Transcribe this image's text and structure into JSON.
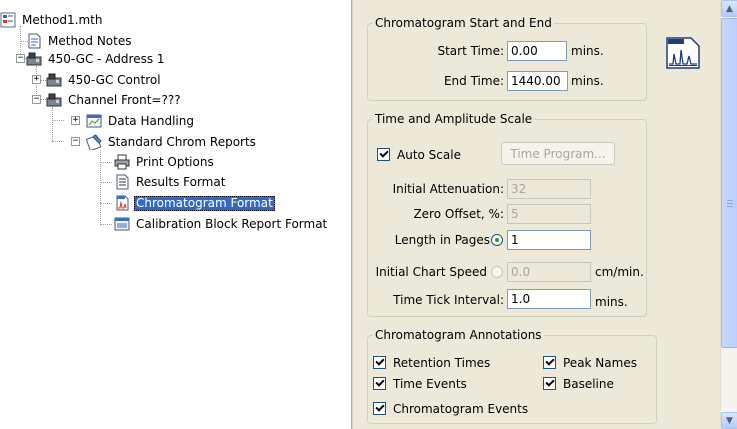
{
  "tree": {
    "root": {
      "label": "Method1.mth"
    },
    "method_notes": {
      "label": "Method Notes"
    },
    "address": {
      "label": "450-GC - Address 1"
    },
    "gc_control": {
      "label": "450-GC Control"
    },
    "channel": {
      "label": "Channel Front=???"
    },
    "data_handling": {
      "label": "Data Handling"
    },
    "std_reports": {
      "label": "Standard Chrom Reports"
    },
    "print_options": {
      "label": "Print Options"
    },
    "results_format": {
      "label": "Results Format"
    },
    "chromatogram_format": {
      "label": "Chromatogram Format",
      "selected": true
    },
    "calibration_block": {
      "label": "Calibration Block Report Format"
    }
  },
  "start_end": {
    "legend": "Chromatogram Start and End",
    "start_label": "Start Time:",
    "start_value": "0.00",
    "start_unit": "mins.",
    "end_label": "End Time:",
    "end_value": "1440.00",
    "end_unit": "mins."
  },
  "scale": {
    "legend": "Time and Amplitude Scale",
    "auto_scale_label": "Auto Scale",
    "auto_scale_checked": true,
    "time_program_label": "Time Program...",
    "atten_label": "Initial Attenuation:",
    "atten_value": "32",
    "zero_label": "Zero Offset, %:",
    "zero_value": "5",
    "length_label": "Length in Pages",
    "length_value": "1",
    "length_selected": true,
    "speed_label": "Initial Chart Speed",
    "speed_value": "0.0",
    "speed_unit": "cm/min.",
    "tick_label": "Time Tick Interval:",
    "tick_value": "1.0",
    "tick_unit": "mins."
  },
  "annotations": {
    "legend": "Chromatogram Annotations",
    "retention_times": "Retention Times",
    "peak_names": "Peak Names",
    "time_events": "Time Events",
    "baseline": "Baseline",
    "chromatogram_events": "Chromatogram Events"
  },
  "colors": {
    "panel_bg": "#ece9d8",
    "selection": "#316ac5",
    "check_green": "#21a121"
  }
}
